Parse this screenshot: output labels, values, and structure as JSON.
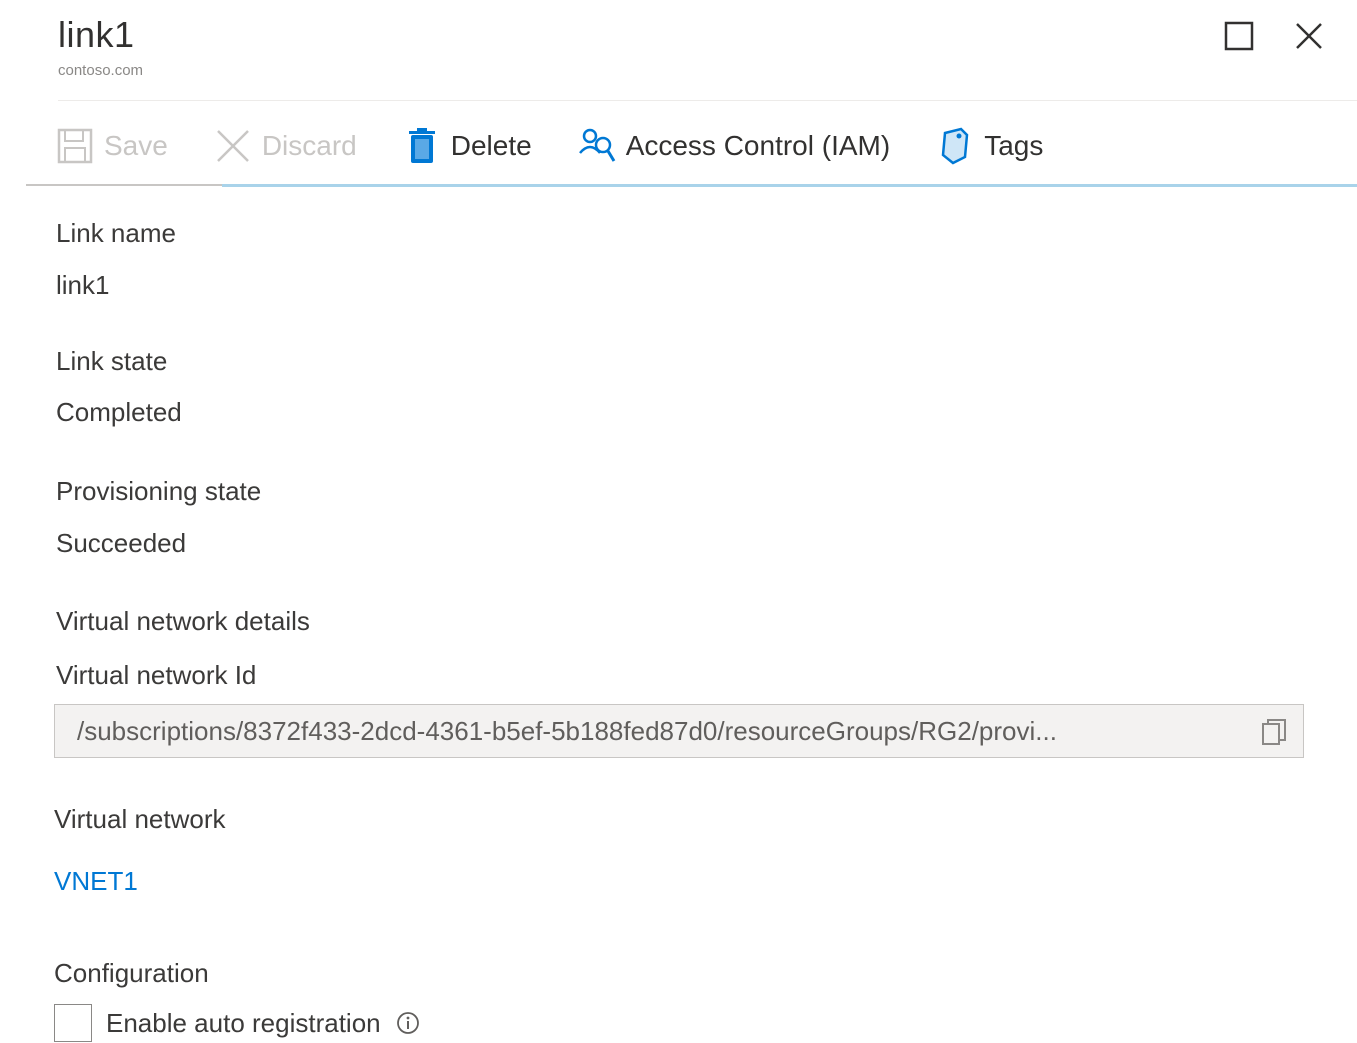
{
  "header": {
    "title": "link1",
    "subtitle": "contoso.com"
  },
  "window_controls": {
    "maximize_icon": "maximize-icon",
    "close_icon": "close-icon"
  },
  "toolbar": {
    "save_label": "Save",
    "discard_label": "Discard",
    "delete_label": "Delete",
    "iam_label": "Access Control (IAM)",
    "tags_label": "Tags"
  },
  "fields": {
    "link_name_label": "Link name",
    "link_name_value": "link1",
    "link_state_label": "Link state",
    "link_state_value": "Completed",
    "provisioning_state_label": "Provisioning state",
    "provisioning_state_value": "Succeeded"
  },
  "vnet_details": {
    "heading": "Virtual network details",
    "id_label": "Virtual network Id",
    "id_value": "/subscriptions/8372f433-2dcd-4361-b5ef-5b188fed87d0/resourceGroups/RG2/provi...",
    "vnet_label": "Virtual network",
    "vnet_value": "VNET1"
  },
  "configuration": {
    "heading": "Configuration",
    "auto_registration_label": "Enable auto registration",
    "auto_registration_checked": false
  },
  "colors": {
    "accent": "#0078d4",
    "disabled": "#c8c6c4",
    "text": "#3b3a39"
  }
}
